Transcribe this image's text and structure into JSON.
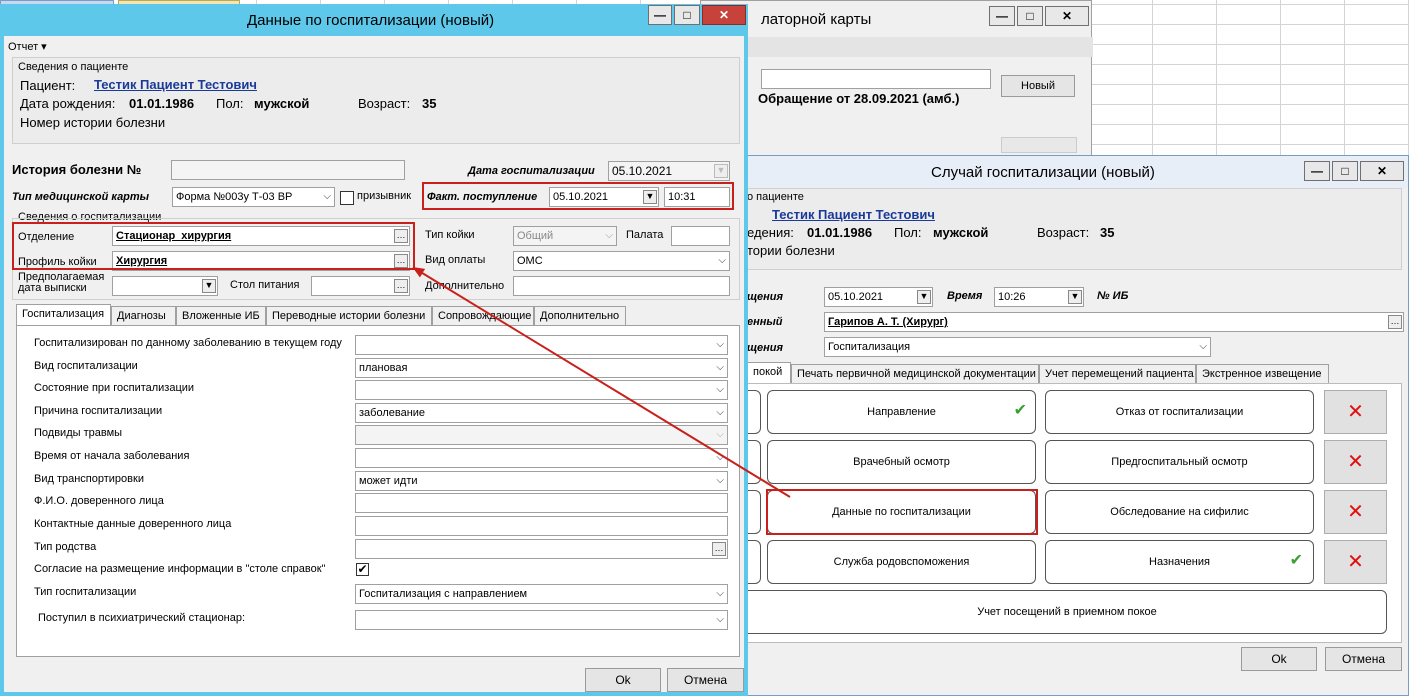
{
  "bg_window": {
    "title": "латорной карты",
    "new_button": "Новый",
    "appeal_text": "Обращение от 28.09.2021 (амб.)"
  },
  "main_window": {
    "title": "Данные по госпитализации (новый)",
    "menu_report": "Отчет ▾",
    "patient_group_title": "Сведения о пациенте",
    "patient_label": "Пациент:",
    "patient_name": "Тестик Пациент Тестович",
    "dob_label": "Дата рождения:",
    "dob_value": "01.01.1986",
    "sex_label": "Пол:",
    "sex_value": "мужской",
    "age_label": "Возраст:",
    "age_value": "35",
    "history_number_label": "Номер истории болезни",
    "illness_history_label": "История болезни №",
    "hosp_date_label": "Дата госпитализации",
    "hosp_date_value": "05.10.2021",
    "card_type_label": "Тип медицинской карты",
    "card_type_value": "Форма №003у Т-03 ВР",
    "conscript_label": "призывник",
    "fact_admission_label": "Факт. поступление",
    "fact_admission_date": "05.10.2021",
    "fact_admission_time": "10:31",
    "hosp_info_title": "Сведения о госпитализации",
    "department_label": "Отделение",
    "department_value": "Стационар_хирургия",
    "bed_type_label": "Тип койки",
    "bed_type_value": "Общий",
    "ward_label": "Палата",
    "bed_profile_label": "Профиль койки",
    "bed_profile_value": "Хирургия",
    "payment_label": "Вид оплаты",
    "payment_value": "ОМС",
    "discharge_label_1": "Предполагаемая",
    "discharge_label_2": "дата выписки",
    "table_label": "Стол питания",
    "additional_label": "Дополнительно",
    "tabs": [
      "Госпитализация",
      "Диагнозы",
      "Вложенные ИБ",
      "Переводные истории болезни",
      "Сопровождающие",
      "Дополнительно"
    ],
    "form_rows": [
      {
        "label": "Госпитализирован по данному заболеванию в текущем году",
        "value": "",
        "kind": "select"
      },
      {
        "label": "Вид госпитализации",
        "value": "плановая",
        "kind": "select"
      },
      {
        "label": "Состояние при госпитализации",
        "value": "",
        "kind": "select"
      },
      {
        "label": "Причина госпитализации",
        "value": "заболевание",
        "kind": "select"
      },
      {
        "label": "Подвиды травмы",
        "value": "",
        "kind": "select-disabled"
      },
      {
        "label": "Время от начала заболевания",
        "value": "",
        "kind": "select"
      },
      {
        "label": "Вид транспортировки",
        "value": "может идти",
        "kind": "select"
      },
      {
        "label": "Ф.И.О. доверенного лица",
        "value": "",
        "kind": "text"
      },
      {
        "label": "Контактные данные доверенного лица",
        "value": "",
        "kind": "text"
      },
      {
        "label": "Тип родства",
        "value": "",
        "kind": "lookup"
      },
      {
        "label": "Согласие на размещение информации в \"столе справок\"",
        "value": "",
        "kind": "checkbox"
      },
      {
        "label": "Тип госпитализации",
        "value": "Госпитализация с направлением",
        "kind": "select"
      },
      {
        "label": "Поступил в психиатрический стационар:",
        "value": "",
        "kind": "select"
      }
    ],
    "ok_button": "Ok",
    "cancel_button": "Отмена"
  },
  "case_window": {
    "title": "Случай госпитализации (новый)",
    "patient_group_title_partial": "о пациенте",
    "patient_name": "Тестик Пациент Тестович",
    "dob_label_partial": "едения:",
    "dob_value": "01.01.1986",
    "sex_label": "Пол:",
    "sex_value": "мужской",
    "age_label": "Возраст:",
    "age_value": "35",
    "history_partial": "тории болезни",
    "date_label_partial": "щения",
    "date_value": "05.10.2021",
    "time_label": "Время",
    "time_value": "10:26",
    "ib_label": "№ ИБ",
    "doctor_label_partial": "енный",
    "doctor_value": "Гарипов А. Т. (Хирург)",
    "kind_label_partial": "щения",
    "kind_value": "Госпитализация",
    "tabs": [
      "покой",
      "Печать первичной медицинской документации",
      "Учет перемещений пациента",
      "Экстренное извещение"
    ],
    "buttons": {
      "referral": "Направление",
      "refusal": "Отказ от госпитализации",
      "doctor_exam": "Врачебный осмотр",
      "prehosp_exam": "Предгоспитальный осмотр",
      "hosp_data": "Данные по госпитализации",
      "syphilis": "Обследование на сифилис",
      "obstetric": "Служба родовспоможения",
      "prescriptions": "Назначения",
      "visits": "Учет посещений в приемном покое"
    },
    "ok_button": "Ok",
    "cancel_button": "Отмена"
  },
  "colors": {
    "highlight_red": "#c8201a",
    "main_title_bar": "#5ec8ea",
    "case_title_bar": "#e8eef7",
    "link_blue": "#1a3a9a"
  }
}
